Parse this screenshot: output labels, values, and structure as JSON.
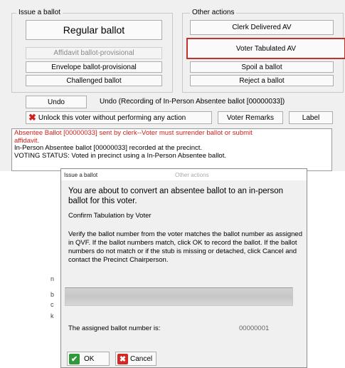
{
  "issue_group": {
    "title": "Issue a ballot",
    "regular_ballot": "Regular ballot",
    "affidavit_ballot": "Affidavit ballot-provisional",
    "envelope_ballot": "Envelope ballot-provisional",
    "challenged_ballot": "Challenged ballot"
  },
  "other_group": {
    "title": "Other actions",
    "clerk_delivered": "Clerk Delivered AV",
    "voter_tabulated": "Voter Tabulated AV",
    "spoil": "Spoil a ballot",
    "reject": "Reject a ballot"
  },
  "undo": {
    "button": "Undo",
    "description": "Undo (Recording of In-Person Absentee ballot [00000033])"
  },
  "unlock_label": "Unlock this voter without performing any action",
  "voter_remarks": "Voter Remarks",
  "label_button": "Label",
  "log": {
    "line1": "Absentee Ballot [00000033] sent by clerk--Voter must surrender ballot or submit",
    "line2": "affidavit.",
    "line3": "In-Person Absentee ballot [00000033] recorded at the precinct.",
    "line4": "VOTING STATUS: Voted in precinct using a In-Person Absentee ballot."
  },
  "strip_fragments": [
    "n",
    "b",
    "c",
    "k"
  ],
  "dialog": {
    "title": "Issue a ballot",
    "under_text": "Other actions",
    "heading": "You are about to convert an absentee ballot to an in-person ballot for this voter.",
    "subheading": "Confirm Tabulation by Voter",
    "instructions": "Verify the ballot number from the voter matches the ballot number as assigned in QVF.  If the ballot numbers match, click OK to record the ballot.  If the ballot numbers do not match or if the stub is missing or detached, click Cancel and contact the Precinct Chairperson.",
    "assigned_label": "The assigned ballot number is:",
    "assigned_value": "00000001",
    "ok": "OK",
    "cancel": "Cancel"
  },
  "colors": {
    "highlight": "#c0342d",
    "log_red": "#d0201c",
    "ok_green": "#2e9a3a",
    "cancel_red": "#d02a22"
  },
  "icons": {
    "unlock": "red-x-icon",
    "ok": "green-check-icon",
    "cancel": "red-x-icon"
  }
}
